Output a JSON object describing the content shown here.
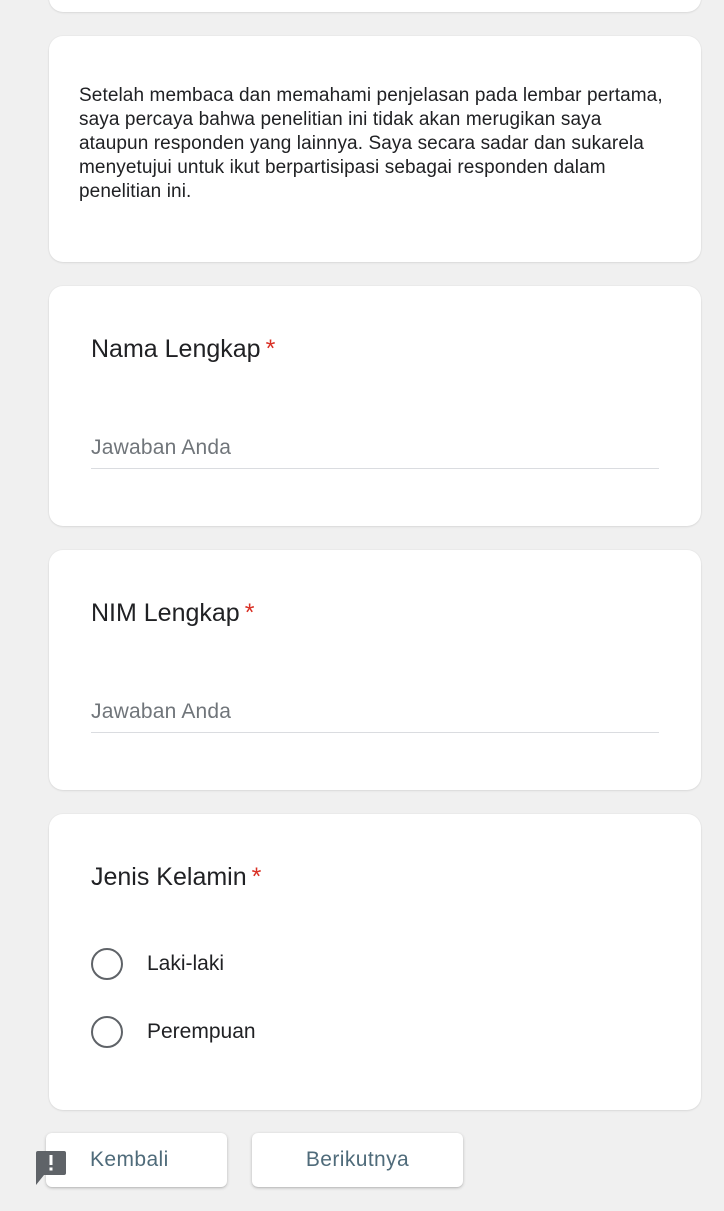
{
  "description": {
    "text": "Setelah membaca dan memahami penjelasan pada lembar pertama, saya percaya bahwa penelitian ini tidak akan merugikan saya ataupun responden yang lainnya. Saya secara sadar dan sukarela menyetujui untuk ikut berpartisipasi sebagai responden dalam penelitian ini."
  },
  "questions": [
    {
      "title": "Nama Lengkap",
      "required_mark": "*",
      "placeholder": "Jawaban Anda"
    },
    {
      "title": "NIM Lengkap",
      "required_mark": "*",
      "placeholder": "Jawaban Anda"
    },
    {
      "title": "Jenis Kelamin",
      "required_mark": "*",
      "options": [
        "Laki-laki",
        "Perempuan"
      ]
    }
  ],
  "navigation": {
    "back_label": "Kembali",
    "next_label": "Berikutnya"
  },
  "icons": {
    "feedback": "feedback-icon",
    "radio": "radio-unchecked-icon"
  },
  "colors": {
    "background": "#f0f0f0",
    "card": "#ffffff",
    "required": "#d93025",
    "button_text": "#4f6b7a",
    "placeholder": "#70757a"
  }
}
